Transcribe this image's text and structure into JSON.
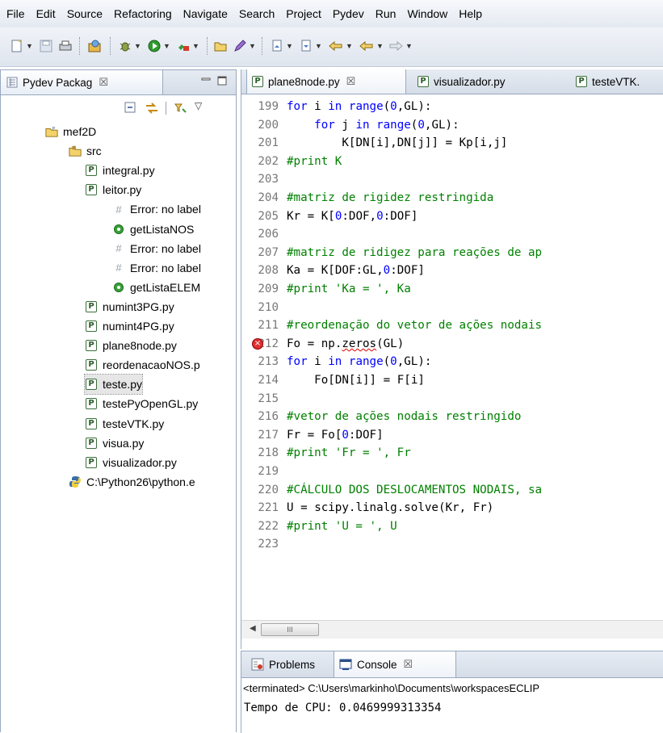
{
  "menu": [
    "File",
    "Edit",
    "Source",
    "Refactoring",
    "Navigate",
    "Search",
    "Project",
    "Pydev",
    "Run",
    "Window",
    "Help"
  ],
  "left_panel": {
    "tab_label": "Pydev Packag",
    "close": "☒",
    "tree": [
      {
        "label": "mef2D",
        "type": "project"
      },
      {
        "label": "src",
        "type": "folder"
      },
      {
        "label": "integral.py",
        "type": "pyfile"
      },
      {
        "label": "leitor.py",
        "type": "pyfile"
      },
      {
        "label": "Error: no label",
        "type": "hash"
      },
      {
        "label": "getListaNOS",
        "type": "func"
      },
      {
        "label": "Error: no label",
        "type": "hash"
      },
      {
        "label": "Error: no label",
        "type": "hash"
      },
      {
        "label": "getListaELEM",
        "type": "func"
      },
      {
        "label": "numint3PG.py",
        "type": "pyfile"
      },
      {
        "label": "numint4PG.py",
        "type": "pyfile"
      },
      {
        "label": "plane8node.py",
        "type": "pyfile"
      },
      {
        "label": "reordenacaoNOS.p",
        "type": "pyfile"
      },
      {
        "label": "teste.py",
        "type": "pyfile",
        "selected": true
      },
      {
        "label": "testePyOpenGL.py",
        "type": "pyfile"
      },
      {
        "label": "testeVTK.py",
        "type": "pyfile"
      },
      {
        "label": "visua.py",
        "type": "pyfile"
      },
      {
        "label": "visualizador.py",
        "type": "pyfile"
      },
      {
        "label": "C:\\Python26\\python.e",
        "type": "python"
      }
    ]
  },
  "editor": {
    "tabs": [
      {
        "label": "plane8node.py",
        "active": true
      },
      {
        "label": "visualizador.py"
      },
      {
        "label": "testeVTK."
      }
    ],
    "lines": [
      {
        "n": "199",
        "code": "for i in range(0,GL):",
        "kind": "code"
      },
      {
        "n": "200",
        "code": "    for j in range(0,GL):",
        "kind": "code"
      },
      {
        "n": "201",
        "code": "        K[DN[i],DN[j]] = Kp[i,j]",
        "kind": "code"
      },
      {
        "n": "202",
        "code": "#print K",
        "kind": "comment"
      },
      {
        "n": "203",
        "code": "",
        "kind": "code"
      },
      {
        "n": "204",
        "code": "#matriz de rigidez restringida",
        "kind": "comment"
      },
      {
        "n": "205",
        "code": "Kr = K[0:DOF,0:DOF]",
        "kind": "code"
      },
      {
        "n": "206",
        "code": "",
        "kind": "code"
      },
      {
        "n": "207",
        "code": "#matriz de ridigez para reações de ap",
        "kind": "comment"
      },
      {
        "n": "208",
        "code": "Ka = K[DOF:GL,0:DOF]",
        "kind": "code"
      },
      {
        "n": "209",
        "code": "#print 'Ka = ', Ka",
        "kind": "comment"
      },
      {
        "n": "210",
        "code": "",
        "kind": "code"
      },
      {
        "n": "211",
        "code": "#reordenação do vetor de ações nodais",
        "kind": "comment"
      },
      {
        "n": "212",
        "code": "Fo = np.zeros(GL)",
        "kind": "code",
        "error": true
      },
      {
        "n": "213",
        "code": "for i in range(0,GL):",
        "kind": "code"
      },
      {
        "n": "214",
        "code": "    Fo[DN[i]] = F[i]",
        "kind": "code"
      },
      {
        "n": "215",
        "code": "",
        "kind": "code"
      },
      {
        "n": "216",
        "code": "#vetor de ações nodais restringido",
        "kind": "comment"
      },
      {
        "n": "217",
        "code": "Fr = Fo[0:DOF]",
        "kind": "code"
      },
      {
        "n": "218",
        "code": "#print 'Fr = ', Fr",
        "kind": "comment"
      },
      {
        "n": "219",
        "code": "",
        "kind": "code"
      },
      {
        "n": "220",
        "code": "#CÁLCULO DOS DESLOCAMENTOS NODAIS, sa",
        "kind": "comment"
      },
      {
        "n": "221",
        "code": "U = scipy.linalg.solve(Kr, Fr)",
        "kind": "code"
      },
      {
        "n": "222",
        "code": "#print 'U = ', U",
        "kind": "comment"
      },
      {
        "n": "223",
        "code": "",
        "kind": "code"
      }
    ],
    "scroll_thumb": "III"
  },
  "console": {
    "tabs": [
      {
        "label": "Problems"
      },
      {
        "label": "Console",
        "active": true
      }
    ],
    "status": "<terminated> C:\\Users\\markinho\\Documents\\workspacesECLIP",
    "output": "Tempo de CPU: 0.0469999313354"
  },
  "colors": {
    "keyword": "#0000ff",
    "comment": "#008000",
    "line_number": "#787878",
    "error": "#e00000"
  }
}
